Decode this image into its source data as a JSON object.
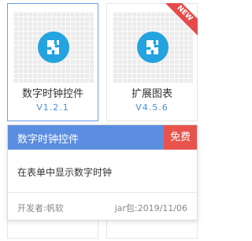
{
  "cards": [
    {
      "title": "数字时钟控件",
      "version": "V1.2.1",
      "icon": "puzzle-icon",
      "selected": true
    },
    {
      "title": "扩展图表",
      "version": "V4.5.6",
      "icon": "puzzle-icon",
      "ribbon": "NEW"
    }
  ],
  "popup": {
    "title": "数字时钟控件",
    "badge": "免费",
    "description": "在表单中显示数字时钟",
    "developer": "开发者:帆软",
    "jar_date": "jar包:2019/11/06"
  },
  "colors": {
    "accent": "#5b8ee0",
    "badge": "#e8534d",
    "icon": "#23a3df",
    "version_text": "#4a90d9"
  }
}
